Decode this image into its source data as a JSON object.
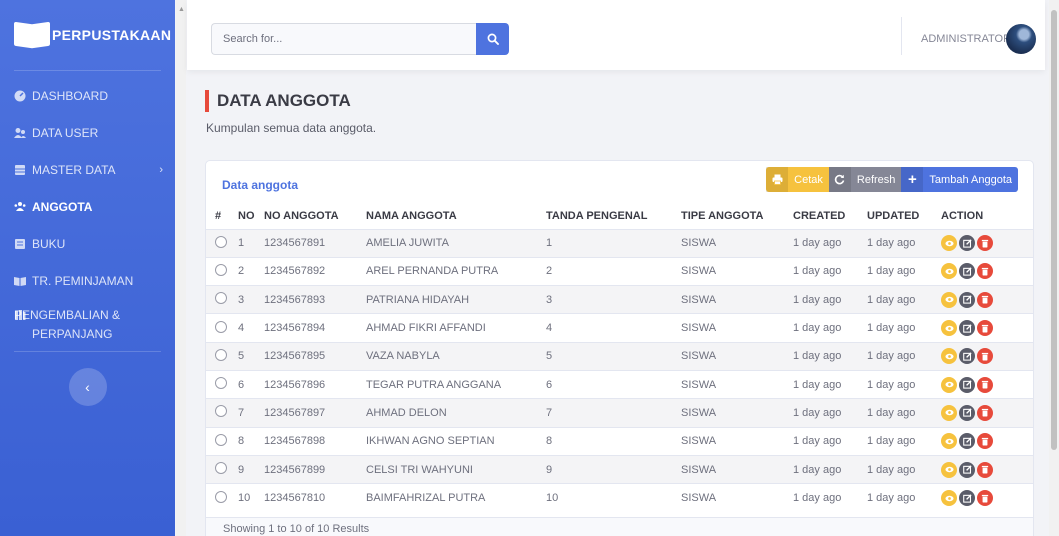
{
  "brand": {
    "name": "PERPUSTAKAAN"
  },
  "sidebar": {
    "items": [
      {
        "label": "DASHBOARD",
        "icon": "dashboard-icon"
      },
      {
        "label": "DATA USER",
        "icon": "users-icon"
      },
      {
        "label": "MASTER DATA",
        "icon": "database-icon"
      },
      {
        "label": "ANGGOTA",
        "icon": "members-icon"
      },
      {
        "label": "BUKU",
        "icon": "book-icon"
      },
      {
        "label": "TR. PEMINJAMAN",
        "icon": "book-open-icon"
      },
      {
        "label": "PENGEMBALIAN & PERPANJANG",
        "icon": "books-icon"
      }
    ],
    "toggle": "‹"
  },
  "search": {
    "placeholder": "Search for..."
  },
  "user": {
    "name": "ADMINISTRATOR"
  },
  "page": {
    "title": "DATA ANGGOTA",
    "subtitle": "Kumpulan semua data anggota."
  },
  "card": {
    "title": "Data anggota",
    "buttons": {
      "print": "Cetak",
      "refresh": "Refresh",
      "add": "Tambah Anggota"
    },
    "footer": "Showing 1 to 10 of 10 Results"
  },
  "table": {
    "headers": [
      "#",
      "NO",
      "NO ANGGOTA",
      "NAMA ANGGOTA",
      "TANDA PENGENAL",
      "TIPE ANGGOTA",
      "CREATED",
      "UPDATED",
      "ACTION"
    ],
    "rows": [
      {
        "no": "1",
        "no_anggota": "1234567891",
        "nama": "AMELIA JUWITA",
        "tanda": "1",
        "tipe": "SISWA",
        "created": "1 day ago",
        "updated": "1 day ago"
      },
      {
        "no": "2",
        "no_anggota": "1234567892",
        "nama": "AREL PERNANDA PUTRA",
        "tanda": "2",
        "tipe": "SISWA",
        "created": "1 day ago",
        "updated": "1 day ago"
      },
      {
        "no": "3",
        "no_anggota": "1234567893",
        "nama": "PATRIANA HIDAYAH",
        "tanda": "3",
        "tipe": "SISWA",
        "created": "1 day ago",
        "updated": "1 day ago"
      },
      {
        "no": "4",
        "no_anggota": "1234567894",
        "nama": "AHMAD FIKRI AFFANDI",
        "tanda": "4",
        "tipe": "SISWA",
        "created": "1 day ago",
        "updated": "1 day ago"
      },
      {
        "no": "5",
        "no_anggota": "1234567895",
        "nama": "VAZA NABYLA",
        "tanda": "5",
        "tipe": "SISWA",
        "created": "1 day ago",
        "updated": "1 day ago"
      },
      {
        "no": "6",
        "no_anggota": "1234567896",
        "nama": "TEGAR PUTRA ANGGANA",
        "tanda": "6",
        "tipe": "SISWA",
        "created": "1 day ago",
        "updated": "1 day ago"
      },
      {
        "no": "7",
        "no_anggota": "1234567897",
        "nama": "AHMAD DELON",
        "tanda": "7",
        "tipe": "SISWA",
        "created": "1 day ago",
        "updated": "1 day ago"
      },
      {
        "no": "8",
        "no_anggota": "1234567898",
        "nama": "IKHWAN AGNO SEPTIAN",
        "tanda": "8",
        "tipe": "SISWA",
        "created": "1 day ago",
        "updated": "1 day ago"
      },
      {
        "no": "9",
        "no_anggota": "1234567899",
        "nama": "CELSI TRI WAHYUNI",
        "tanda": "9",
        "tipe": "SISWA",
        "created": "1 day ago",
        "updated": "1 day ago"
      },
      {
        "no": "10",
        "no_anggota": "1234567810",
        "nama": "BAIMFAHRIZAL PUTRA",
        "tanda": "10",
        "tipe": "SISWA",
        "created": "1 day ago",
        "updated": "1 day ago"
      }
    ]
  },
  "colors": {
    "primary": "#4e73df",
    "warning": "#f6c23e",
    "secondary": "#858796",
    "danger": "#e74a3b"
  }
}
